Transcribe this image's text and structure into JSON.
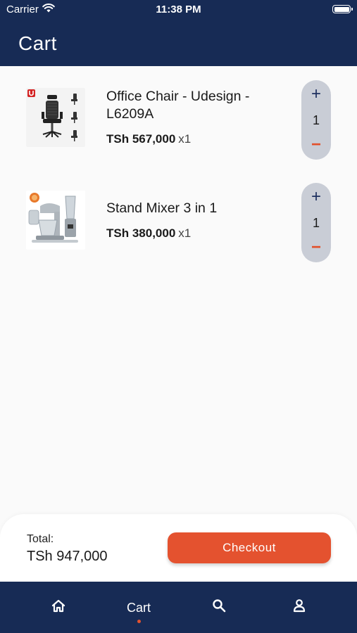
{
  "status_bar": {
    "carrier": "Carrier",
    "time": "11:38 PM"
  },
  "header": {
    "title": "Cart"
  },
  "cart": {
    "items": [
      {
        "name": "Office Chair - Udesign - L6209A",
        "price": "TSh 567,000",
        "qty_label": "x1",
        "quantity": "1",
        "image_icon": "office-chair-product-image"
      },
      {
        "name": "Stand Mixer 3 in 1",
        "price": "TSh 380,000",
        "qty_label": "x1",
        "quantity": "1",
        "image_icon": "stand-mixer-product-image"
      }
    ]
  },
  "stepper": {
    "plus_symbol": "+",
    "minus_symbol": "−"
  },
  "footer": {
    "total_label": "Total:",
    "total_value": "TSh 947,000",
    "checkout_label": "Checkout"
  },
  "tabbar": {
    "active_tab": "Cart",
    "tabs": [
      {
        "icon": "home-icon"
      },
      {
        "label": "Cart"
      },
      {
        "icon": "search-icon"
      },
      {
        "icon": "profile-icon"
      }
    ]
  },
  "colors": {
    "primary": "#172b55",
    "accent": "#e4522f",
    "stepper_bg": "#c9cdd6",
    "background": "#fafafa"
  }
}
